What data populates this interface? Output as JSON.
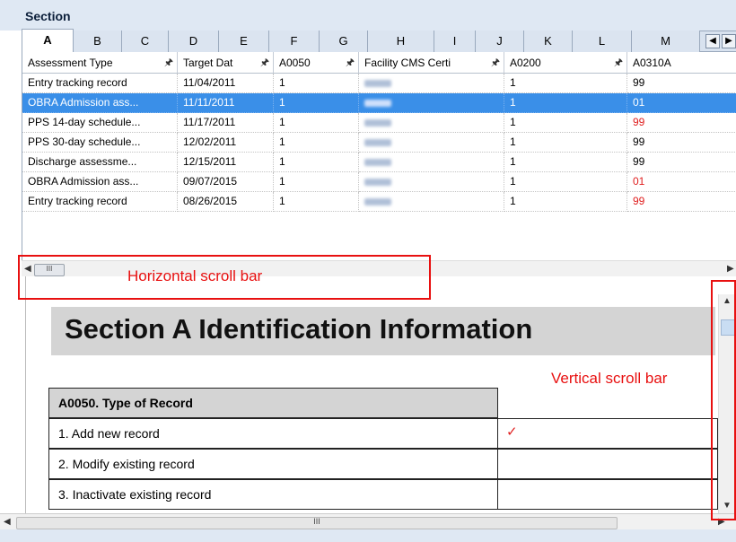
{
  "section_label": "Section",
  "tabs": [
    "A",
    "B",
    "C",
    "D",
    "E",
    "F",
    "G",
    "H",
    "I",
    "J",
    "K",
    "L",
    "M"
  ],
  "active_tab": "A",
  "grid": {
    "headers": [
      "Assessment Type",
      "Target Dat",
      "A0050",
      "Facility CMS Certi",
      "A0200",
      "A0310A"
    ],
    "rows": [
      {
        "type": "Entry tracking record",
        "date": "11/04/2011",
        "a0050": "1",
        "a0200": "1",
        "a0310a": "99",
        "red": false,
        "selected": false
      },
      {
        "type": "OBRA Admission ass...",
        "date": "11/11/2011",
        "a0050": "1",
        "a0200": "1",
        "a0310a": "01",
        "red": false,
        "selected": true
      },
      {
        "type": "PPS 14-day schedule...",
        "date": "11/17/2011",
        "a0050": "1",
        "a0200": "1",
        "a0310a": "99",
        "red": true,
        "selected": false
      },
      {
        "type": "PPS 30-day schedule...",
        "date": "12/02/2011",
        "a0050": "1",
        "a0200": "1",
        "a0310a": "99",
        "red": false,
        "selected": false
      },
      {
        "type": "Discharge assessme...",
        "date": "12/15/2011",
        "a0050": "1",
        "a0200": "1",
        "a0310a": "99",
        "red": false,
        "selected": false
      },
      {
        "type": "OBRA Admission ass...",
        "date": "09/07/2015",
        "a0050": "1",
        "a0200": "1",
        "a0310a": "01",
        "red": true,
        "selected": false
      },
      {
        "type": "Entry tracking record",
        "date": "08/26/2015",
        "a0050": "1",
        "a0200": "1",
        "a0310a": "99",
        "red": true,
        "selected": false
      }
    ]
  },
  "annotations": {
    "horizontal": "Horizontal scroll bar",
    "vertical": "Vertical scroll bar"
  },
  "document": {
    "title": "Section A Identification Information",
    "table_header": "A0050. Type of Record",
    "options": [
      {
        "label": "1. Add new record",
        "check": "✓"
      },
      {
        "label": "2. Modify existing record",
        "check": ""
      },
      {
        "label": "3. Inactivate existing record",
        "check": ""
      }
    ]
  },
  "scrollbar_grip": "III",
  "icons": {
    "pin": "pin-icon",
    "left_arrow": "scroll-left-arrow-icon",
    "right_arrow": "scroll-right-arrow-icon",
    "tab_nav": "tab-scroll-left-icon"
  },
  "colors": {
    "selection": "#3a8fe8",
    "annotation": "#e81010",
    "header_bg": "#dfe8f3"
  }
}
